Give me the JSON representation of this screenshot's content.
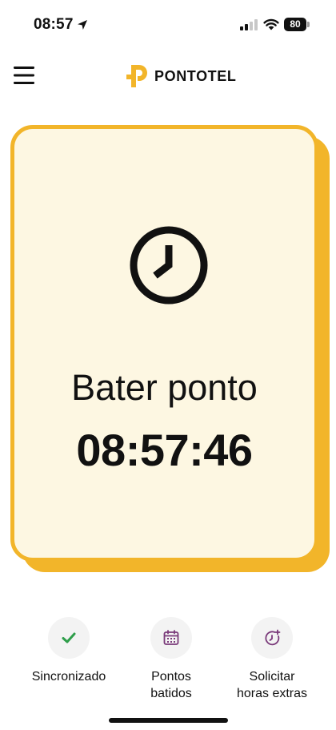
{
  "status_bar": {
    "time": "08:57",
    "battery_level": "80",
    "icons": [
      "location-arrow-icon",
      "cellular-signal-icon",
      "wifi-icon",
      "battery-icon"
    ]
  },
  "header": {
    "menu_icon": "hamburger-menu-icon",
    "logo_text": "PONTOTEL"
  },
  "card": {
    "icon": "clock-icon",
    "title": "Bater ponto",
    "time": "08:57:46"
  },
  "actions": [
    {
      "icon": "check-icon",
      "label_lines": [
        "Sincronizado"
      ]
    },
    {
      "icon": "calendar-icon",
      "label_lines": [
        "Pontos",
        "batidos"
      ]
    },
    {
      "icon": "clock-plus-icon",
      "label_lines": [
        "Solicitar",
        "horas extras"
      ]
    }
  ],
  "colors": {
    "brand_yellow": "#f2b52a",
    "card_background": "#fdf7e2",
    "check_green": "#2e9e4a",
    "icon_purple": "#7a3a7a",
    "action_circle": "#f3f3f3"
  }
}
